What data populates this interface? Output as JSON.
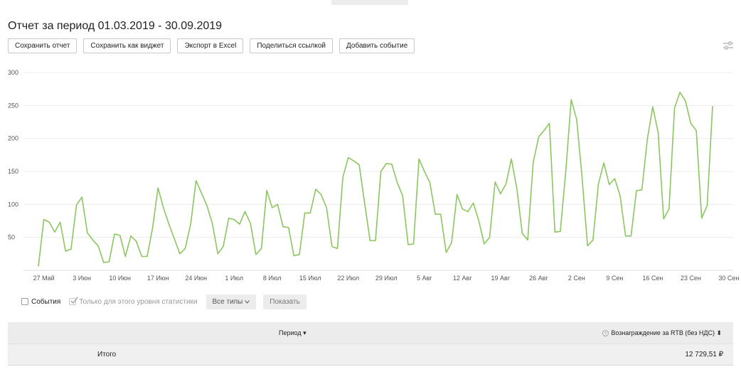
{
  "report": {
    "title": "Отчет за период 01.03.2019 - 30.09.2019"
  },
  "toolbar": {
    "save_report": "Сохранить отчет",
    "save_widget": "Сохранить как виджет",
    "export_excel": "Экспорт в Excel",
    "share_link": "Поделиться ссылкой",
    "add_event": "Добавить событие",
    "settings_icon": "sliders-icon"
  },
  "chart_data": {
    "type": "line",
    "ylim": [
      0,
      300
    ],
    "y_ticks": [
      "300",
      "250",
      "200",
      "150",
      "100",
      "50"
    ],
    "x_ticks": [
      "27 Май",
      "3 Июн",
      "10 Июн",
      "17 Июн",
      "24 Июн",
      "1 Июл",
      "8 Июл",
      "15 Июл",
      "22 Июл",
      "29 Июл",
      "5 Авг",
      "12 Авг",
      "19 Авг",
      "26 Авг",
      "2 Сен",
      "9 Сен",
      "16 Сен",
      "23 Сен",
      "30 Сен"
    ],
    "grid": true,
    "series_color": "#8cc65f",
    "series": [
      {
        "values": [
          6,
          77,
          73,
          58,
          73,
          29,
          32,
          99,
          111,
          57,
          46,
          37,
          12,
          13,
          55,
          53,
          21,
          52,
          44,
          21,
          21,
          64,
          125,
          95,
          70,
          48,
          25,
          33,
          70,
          136,
          117,
          98,
          71,
          25,
          36,
          79,
          77,
          70,
          89,
          71,
          24,
          33,
          121,
          95,
          100,
          66,
          65,
          22,
          24,
          87,
          87,
          123,
          115,
          95,
          36,
          33,
          141,
          171,
          166,
          160,
          102,
          45,
          45,
          150,
          162,
          161,
          133,
          113,
          39,
          40,
          169,
          150,
          133,
          85,
          85,
          27,
          42,
          115,
          93,
          89,
          102,
          75,
          40,
          50,
          134,
          116,
          131,
          169,
          124,
          56,
          46,
          163,
          202,
          212,
          223,
          58,
          59,
          150,
          259,
          229,
          141,
          37,
          46,
          131,
          163,
          130,
          139,
          113,
          52,
          52,
          121,
          122,
          199,
          248,
          209,
          78,
          93,
          246,
          270,
          257,
          223,
          212,
          79,
          98,
          249
        ]
      }
    ]
  },
  "controls": {
    "events_label": "События",
    "level_only_label": "Только для этого уровня статистики",
    "all_types": "Все типы",
    "show": "Показать"
  },
  "table": {
    "col_period": "Период ▾",
    "col_reward": "Вознаграждение за RTB (без НДС) ⬍",
    "total_label": "Итого",
    "total_value": "12 729,51 ₽"
  }
}
